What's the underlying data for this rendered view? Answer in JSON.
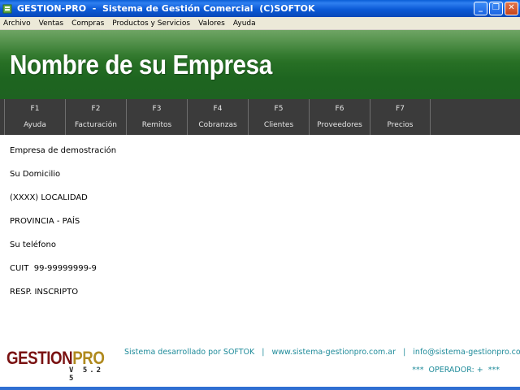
{
  "window": {
    "title": "GESTION-PRO  -  Sistema de Gestión Comercial  (C)SOFTOK",
    "minimize_glyph": "_",
    "restore_glyph": "❐",
    "close_glyph": "✕"
  },
  "menubar": {
    "items": [
      "Archivo",
      "Ventas",
      "Compras",
      "Productos y Servicios",
      "Valores",
      "Ayuda"
    ]
  },
  "banner": {
    "company_name": "Nombre de su Empresa"
  },
  "function_keys": [
    {
      "key": "F1",
      "label": "Ayuda"
    },
    {
      "key": "F2",
      "label": "Facturación"
    },
    {
      "key": "F3",
      "label": "Remitos"
    },
    {
      "key": "F4",
      "label": "Cobranzas"
    },
    {
      "key": "F5",
      "label": "Clientes"
    },
    {
      "key": "F6",
      "label": "Proveedores"
    },
    {
      "key": "F7",
      "label": "Precios"
    }
  ],
  "company_info": {
    "name": "Empresa de demostración",
    "address": "Su Domicilio",
    "locality": "(XXXX) LOCALIDAD",
    "province": "PROVINCIA - PAÍS",
    "phone": "Su teléfono",
    "cuit": "CUIT  99-99999999-9",
    "tax_status": "RESP. INSCRIPTO"
  },
  "footer": {
    "logo_part1": "GESTION",
    "logo_part2": "PRO",
    "version": "V 5.2 5",
    "developed_by": "Sistema desarrollado por SOFTOK",
    "website": "www.sistema-gestionpro.com.ar",
    "email": "info@sistema-gestionpro.com.ar",
    "separator": "|",
    "operator": "***  OPERADOR: +  ***"
  },
  "colors": {
    "banner_green": "#2c7527",
    "toolbar_dark": "#3b3b3b",
    "footer_link": "#1f8b9a",
    "logo_red": "#7a1212",
    "logo_gold": "#b08a1e"
  }
}
